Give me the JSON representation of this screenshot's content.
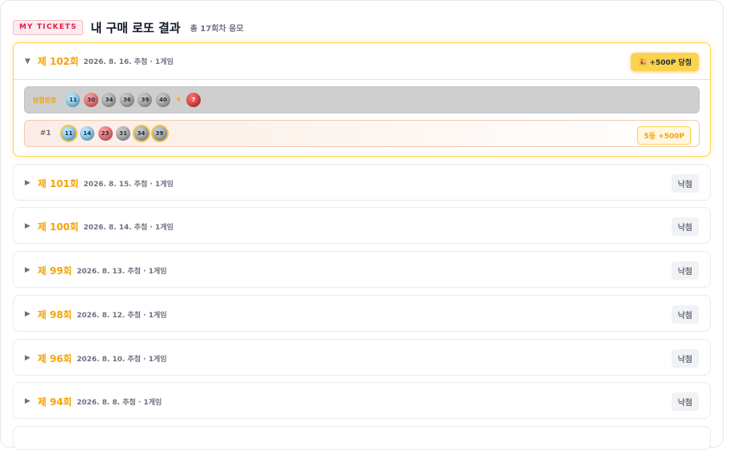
{
  "header": {
    "tag": "MY TICKETS",
    "title": "내 구매 로또 결과",
    "subtitle": "총 17회차 응모"
  },
  "expanded": {
    "arrow": "▼",
    "round": "제 102회",
    "meta": "2026. 8. 16. 추첨 · 1게임",
    "win_badge": "🎉 +500P 당첨",
    "winning_label": "당첨번호",
    "plus": "+",
    "winning_numbers": [
      "11",
      "30",
      "34",
      "36",
      "39",
      "40"
    ],
    "bonus": "7",
    "pick_no": "#1",
    "picks": [
      "11",
      "14",
      "23",
      "31",
      "34",
      "39"
    ],
    "prize": "5등 +500P"
  },
  "collapsed": [
    {
      "arrow": "▶",
      "round": "제 101회",
      "meta": "2026. 8. 15. 추첨 · 1게임",
      "status": "낙첨"
    },
    {
      "arrow": "▶",
      "round": "제 100회",
      "meta": "2026. 8. 14. 추첨 · 1게임",
      "status": "낙첨"
    },
    {
      "arrow": "▶",
      "round": "제 99회",
      "meta": "2026. 8. 13. 추첨 · 1게임",
      "status": "낙첨"
    },
    {
      "arrow": "▶",
      "round": "제 98회",
      "meta": "2026. 8. 12. 추첨 · 1게임",
      "status": "낙첨"
    },
    {
      "arrow": "▶",
      "round": "제 96회",
      "meta": "2026. 8. 10. 추첨 · 1게임",
      "status": "낙첨"
    },
    {
      "arrow": "▶",
      "round": "제 94회",
      "meta": "2026. 8. 8. 추첨 · 1게임",
      "status": "낙첨"
    }
  ],
  "colors": {
    "accent": "#f5a300",
    "win_badge": "#fcd34d",
    "ball_blue": "#63bde8",
    "ball_red": "#e45454",
    "ball_gray": "#9a9a9a",
    "ball_bonus": "#d42a2a"
  }
}
